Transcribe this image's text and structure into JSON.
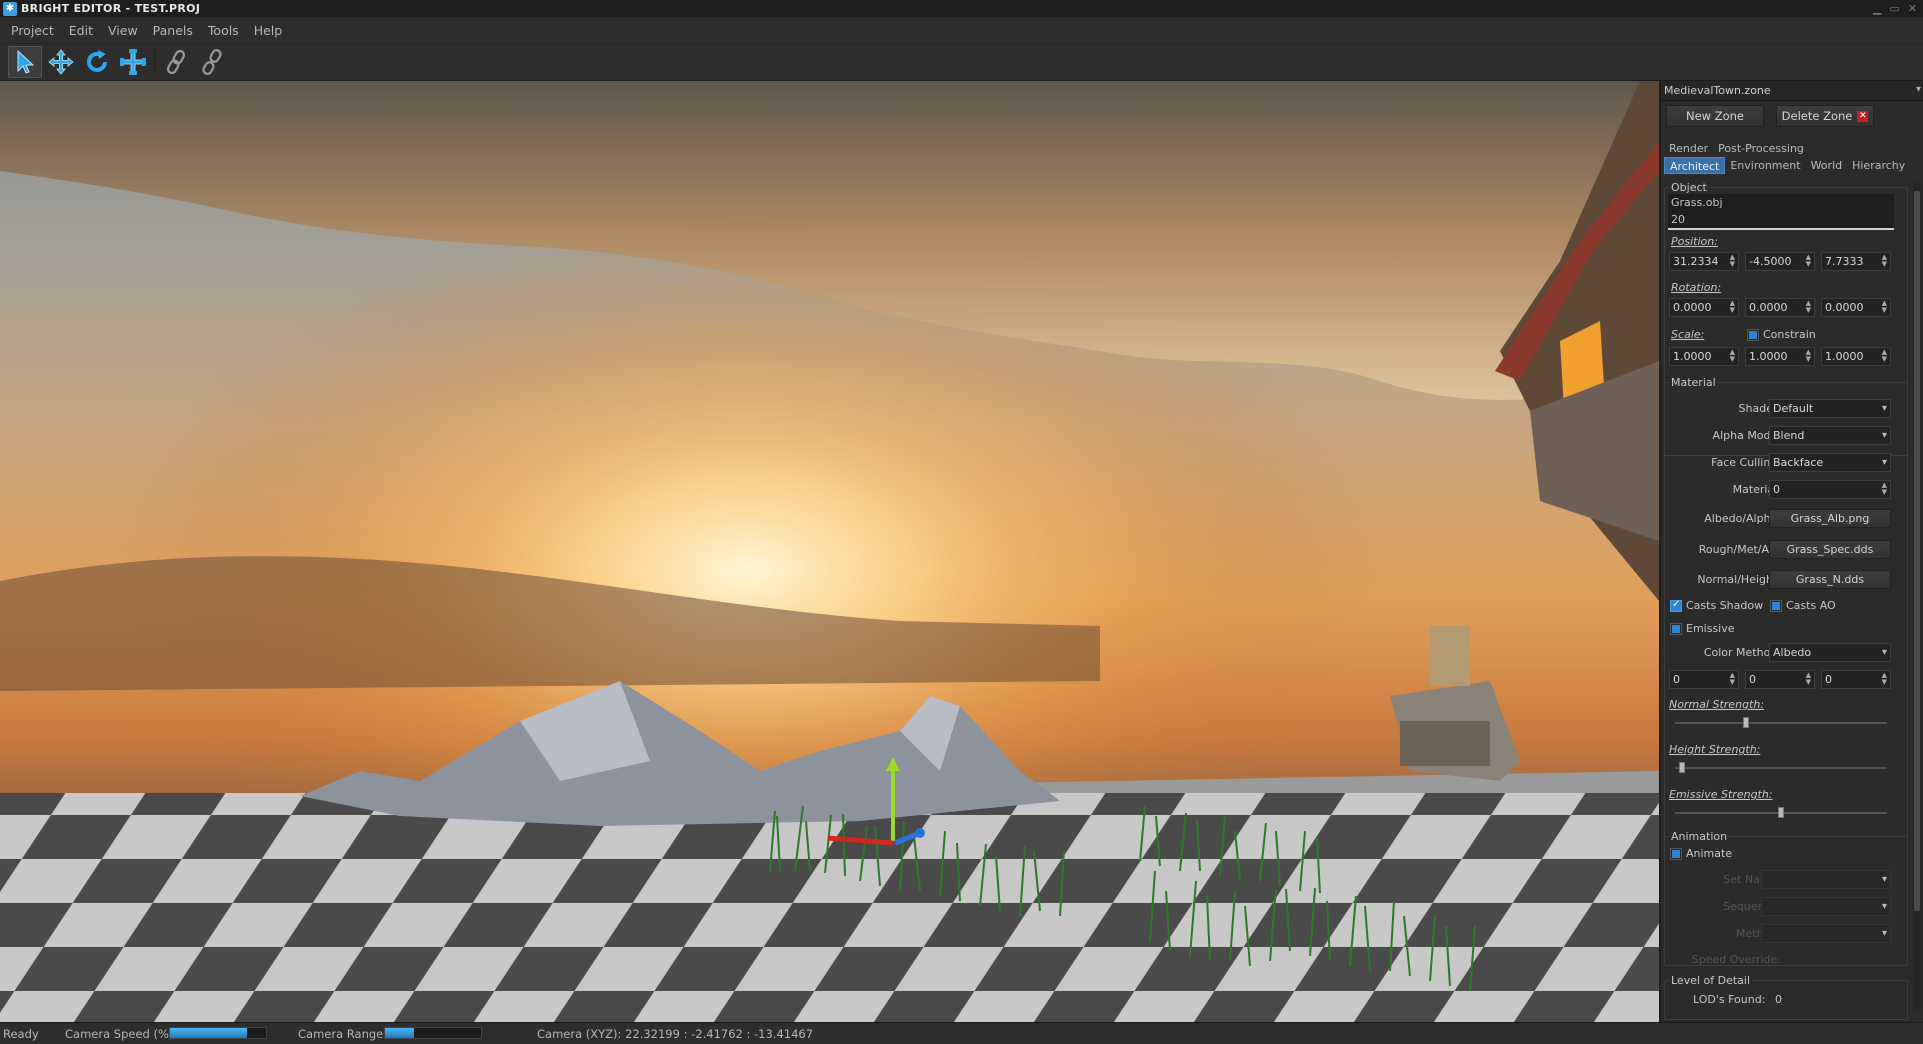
{
  "window": {
    "title": "BRIGHT EDITOR - TEST.PROJ"
  },
  "menu": [
    "Project",
    "Edit",
    "View",
    "Panels",
    "Tools",
    "Help"
  ],
  "toolbar": {
    "tools": [
      "select-tool",
      "move-tool",
      "rotate-tool",
      "scale-tool",
      "link-tool",
      "unlink-tool"
    ],
    "accent": "#2fa6e8"
  },
  "panel": {
    "zone": "MedievalTown.zone",
    "new_zone": "New Zone",
    "delete_zone": "Delete Zone",
    "top_tabs": [
      "Render",
      "Post-Processing"
    ],
    "tabs": [
      "Architect",
      "Environment",
      "World",
      "Hierarchy"
    ],
    "object": {
      "title": "Object",
      "name": "Grass.obj",
      "id": "20",
      "position_label": "Position:",
      "position": [
        "31.2334",
        "-4.5000",
        "7.7333"
      ],
      "rotation_label": "Rotation:",
      "rotation": [
        "0.0000",
        "0.0000",
        "0.0000"
      ],
      "scale_label": "Scale:",
      "constrain": "Constrain",
      "scale": [
        "1.0000",
        "1.0000",
        "1.0000"
      ]
    },
    "material": {
      "title": "Material",
      "shader_label": "Shader:",
      "shader": "Default",
      "alpha_label": "Alpha Mode:",
      "alpha": "Blend",
      "culling_label": "Face Culling:",
      "culling": "Backface",
      "material_label": "Material:",
      "material": "0",
      "albedo_label": "Albedo/Alpha:",
      "albedo": "Grass_Alb.png",
      "rough_label": "Rough/Met/AO:",
      "rough": "Grass_Spec.dds",
      "normal_label": "Normal/Height:",
      "normal": "Grass_N.dds",
      "casts_shadow": "Casts Shadow",
      "casts_ao": "Casts AO",
      "emissive": "Emissive",
      "color_method_label": "Color Method:",
      "color_method": "Albedo",
      "color": [
        "0",
        "0",
        "0"
      ],
      "normal_strength": "Normal Strength:",
      "normal_strength_value": 0.33,
      "height_strength": "Height Strength:",
      "height_strength_value": 0.02,
      "emissive_strength": "Emissive Strength:",
      "emissive_strength_value": 0.5
    },
    "animation": {
      "title": "Animation",
      "animate": "Animate",
      "set_name": "Set Name:",
      "sequence": "Sequence:",
      "method": "Method:",
      "speed_override": "Speed Override:"
    },
    "lod": {
      "title": "Level of Detail",
      "found_label": "LOD's Found:",
      "found": "0"
    }
  },
  "status": {
    "state": "Ready",
    "camera_speed_label": "Camera Speed (%):",
    "camera_speed_value": 0.8,
    "camera_range_label": "Camera Range:",
    "camera_range_value": 0.3,
    "camera_xyz": "Camera (XYZ):  22.32199 : -2.41762 : -13.41467"
  }
}
